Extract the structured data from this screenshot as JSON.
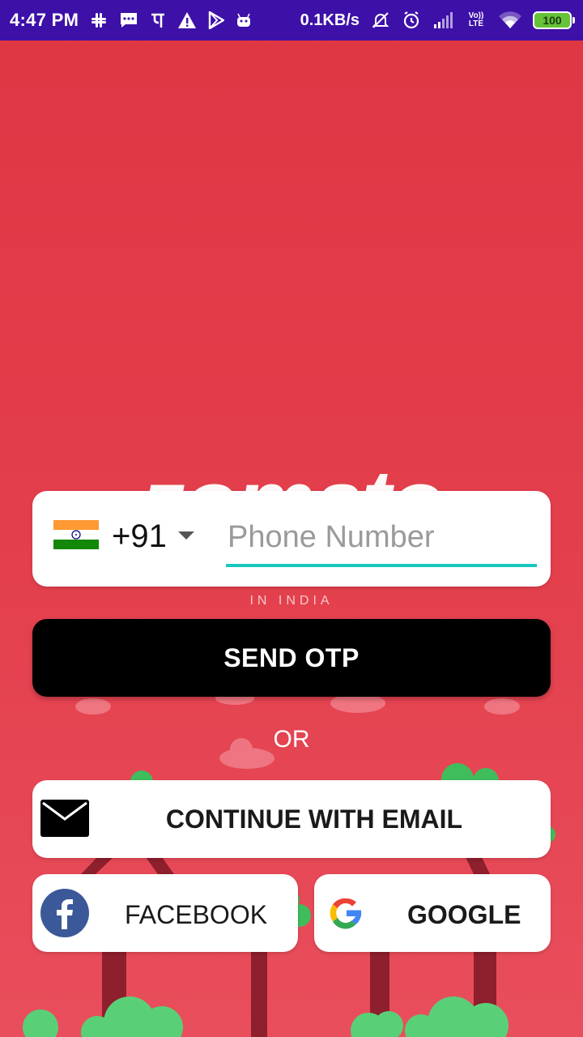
{
  "status_bar": {
    "time": "4:47 PM",
    "network_speed": "0.1KB/s",
    "volte_label": "Vo)) LTE",
    "battery_level": "100",
    "icons": [
      "slack-icon",
      "message-icon",
      "phonepe-icon",
      "warning-icon",
      "play-store-icon",
      "android-icon",
      "muted-alarm-icon",
      "alarm-icon",
      "signal-icon",
      "volte-icon",
      "wifi-icon",
      "battery-icon"
    ]
  },
  "brand": {
    "logo_text": "zomato",
    "tagline": "IN INDIA"
  },
  "phone_login": {
    "country_flag": "india-flag-icon",
    "country_code": "+91",
    "phone_placeholder": "Phone Number",
    "phone_value": ""
  },
  "actions": {
    "send_otp_label": "SEND OTP",
    "or_label": "OR",
    "email_label": "CONTINUE WITH EMAIL",
    "facebook_label": "FACEBOOK",
    "google_label": "GOOGLE"
  },
  "colors": {
    "status_bar": "#3d10a8",
    "background": "#e23a47",
    "input_underline": "#19c7be",
    "send_otp_button": "#000000",
    "facebook_blue": "#3b5998",
    "tree_trunk": "#8e1f2c",
    "foliage": "#4fce6a",
    "battery": "#67c23a"
  }
}
